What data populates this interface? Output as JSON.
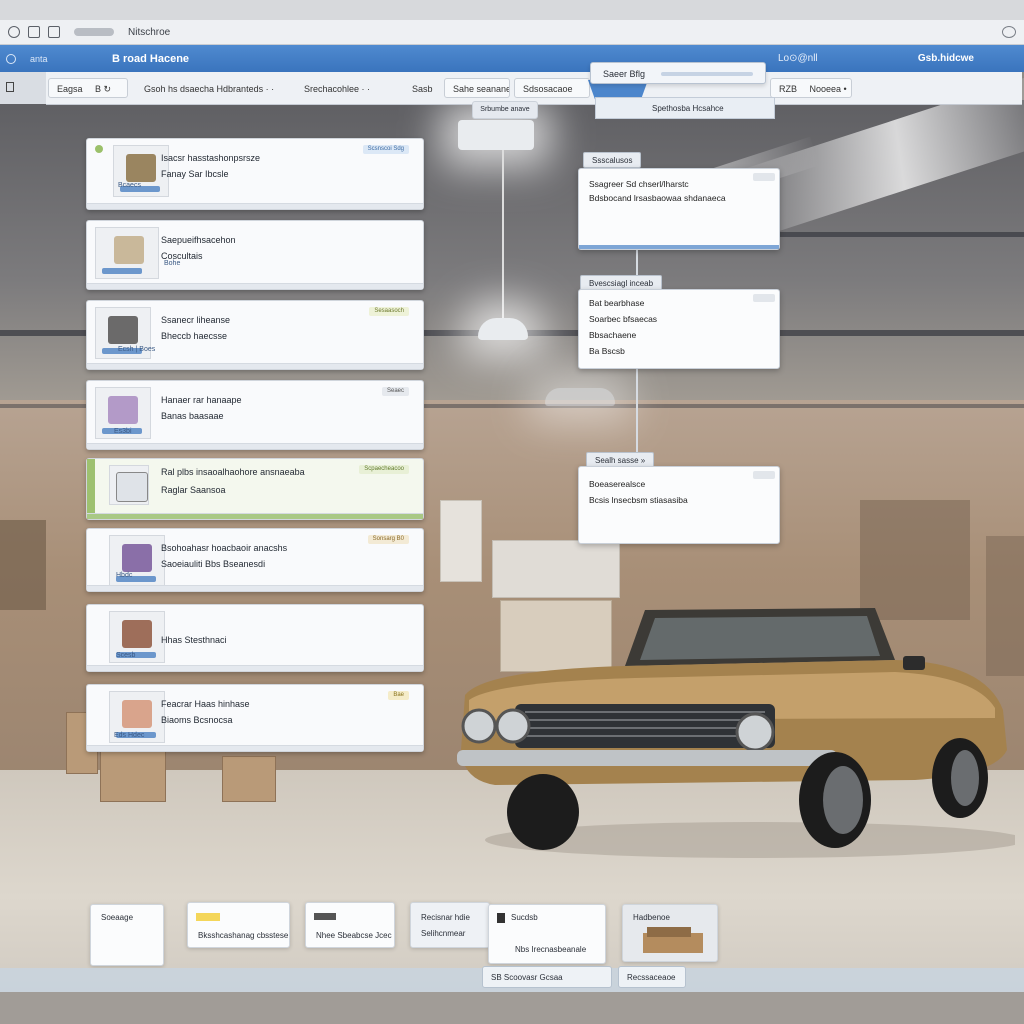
{
  "browser": {
    "url_text": "Nitschroe",
    "colors": {
      "header_blue": "#3a74bd",
      "accent_green": "#9ec170"
    }
  },
  "header": {
    "left_small": "anta",
    "title": "B road Hacene",
    "center": "Lo⊙@nll",
    "right": "Gsb.hidcwe"
  },
  "toolbar": {
    "filter_label": "Eagsa",
    "filter_sep": "B ↻",
    "search_text": "Gsoh hs dsaecha Hdbranteds · ·",
    "sort_text": "Srechacohlee · ·",
    "dd_label": "Sasb",
    "btn1": "Sahe seanane",
    "btn2": "Sdsosacaoe",
    "float_tab": "Saeer Bflg",
    "float_sub": "Spethosba  Hcsahce",
    "pill_left": "Srbumbe anave",
    "btn_right_num": "RZB",
    "btn_right": "Nooeea •"
  },
  "results": [
    {
      "line1": "Isacsr hasstashonpsrsze",
      "line2": "Fanay Sar Ibcsle",
      "badge": "Scsnscoi Sdg"
    },
    {
      "line1": "Saepueifhsacehon",
      "line2": "Coscultais",
      "badge": ""
    },
    {
      "line1": "Ssanecr liheanse",
      "line2": "Bheccb haecsse",
      "badge": "Sesaasoch"
    },
    {
      "line1": "Hanaer rar hanaape",
      "line2": "Banas baasaae",
      "badge": "Seaec"
    },
    {
      "line1": "Ral plbs insaoalhaohore ansnaeaba",
      "line2": "Raglar Saansoa",
      "badge": "Scpaecheacoo"
    },
    {
      "line1": "Bsohoahasr hoacbaoir anacshs",
      "line2": "Saoeiauliti Bbs Bseanesdi",
      "badge": "Sonsarg  B0"
    },
    {
      "line1": "Hhas Stesthnaci",
      "line2": "",
      "badge": ""
    },
    {
      "line1": "Feacrar Haas hinhase",
      "line2": "Biaoms Bcsnocsa",
      "badge": "Bae"
    }
  ],
  "thumb_labels": [
    "Bcaecs",
    "Bohe",
    "Ecsh | Boes",
    "Es3bi",
    "",
    "Hbdc",
    "Scesb",
    "Eds Hdec"
  ],
  "details": [
    {
      "tag": "Ssscalusos",
      "rows": [
        "Ssagreer Sd chserl/lharstc",
        "Bdsbocand lrsasbaowaa shdanaeca"
      ]
    },
    {
      "tag": "Bvescsiagl inceab",
      "rows": [
        "Bat bearbhase",
        "Soarbec bfsaecas",
        "Bbsachaene",
        "Ba Bscsb"
      ]
    },
    {
      "tag": "Sealh sasse »",
      "rows": [
        "Boeaserealsce",
        "Bcsis lnsecbsm stiasasiba"
      ]
    }
  ],
  "dock": {
    "item1": "Soeaage",
    "item2": "Bksshcashanag cbsstese",
    "item3": "Nhee Sbeabcse Jcec",
    "item4a": "Recisnar hdie",
    "item4b": "Selihcnmear",
    "item5a": "Sucdsb",
    "item5b": "Nbs  Irecnasbeanale",
    "item6": "Hadbenoe",
    "btn1": "SB  Scoovasr  Gcsaa",
    "btn2": "Recssaceaoe"
  }
}
